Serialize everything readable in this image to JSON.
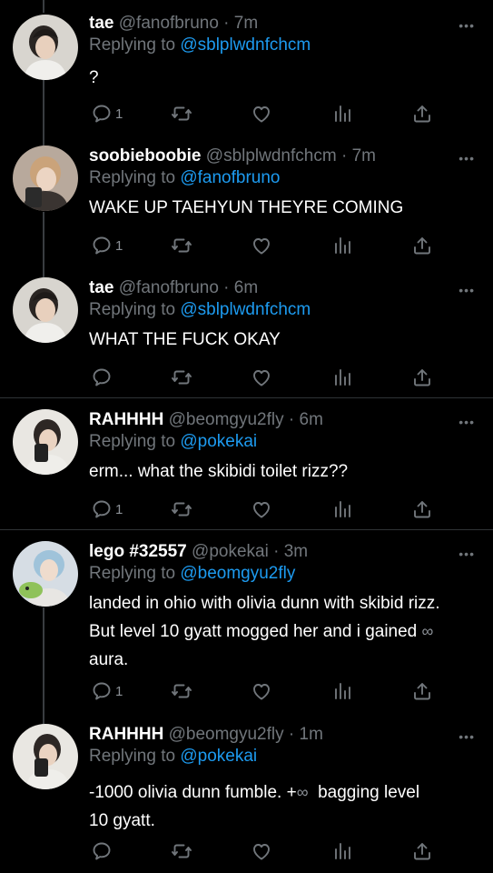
{
  "tweets": [
    {
      "name": "tae",
      "handle": "@fanofbruno",
      "sep": "·",
      "time": "7m",
      "replying_prefix": "Replying to",
      "replying_to": "@sblplwdnfchcm",
      "text": "?",
      "reply_count": "1"
    },
    {
      "name": "soobieboobie",
      "handle": "@sblplwdnfchcm",
      "sep": "·",
      "time": "7m",
      "replying_prefix": "Replying to",
      "replying_to": "@fanofbruno",
      "text": "WAKE UP TAEHYUN THEYRE COMING",
      "reply_count": "1"
    },
    {
      "name": "tae",
      "handle": "@fanofbruno",
      "sep": "·",
      "time": "6m",
      "replying_prefix": "Replying to",
      "replying_to": "@sblplwdnfchcm",
      "text": "WHAT THE FUCK OKAY",
      "reply_count": ""
    },
    {
      "name": "RAHHHH",
      "handle": "@beomgyu2fly",
      "sep": "·",
      "time": "6m",
      "replying_prefix": "Replying to",
      "replying_to": "@pokekai",
      "text": "erm... what the skibidi toilet rizz??",
      "reply_count": "1"
    },
    {
      "name": "lego #32557",
      "handle": "@pokekai",
      "sep": "·",
      "time": "3m",
      "replying_prefix": "Replying to",
      "replying_to": "@beomgyu2fly",
      "text_line1": "landed in ohio with olivia dunn with skibid rizz.",
      "text_line2": "But level 10 gyatt mogged her and i gained",
      "text_inf": "∞",
      "text_line3": "aura.",
      "reply_count": "1"
    },
    {
      "name": "RAHHHH",
      "handle": "@beomgyu2fly",
      "sep": "·",
      "time": "1m",
      "replying_prefix": "Replying to",
      "replying_to": "@pokekai",
      "text_part1": "-1000 olivia dunn fumble. +",
      "text_inf": "∞",
      "text_part2": "  bagging level",
      "text_line2": "10 gyatt.",
      "reply_count": ""
    }
  ],
  "more_glyph": "•••",
  "icons": {
    "reply": "reply-icon",
    "retweet": "retweet-icon",
    "like": "like-icon",
    "views": "views-icon",
    "share": "share-icon"
  },
  "colors": {
    "background": "#000000",
    "text": "#ffffff",
    "secondary": "#71767b",
    "mention": "#1d9bf0",
    "divider": "#2f3336"
  }
}
